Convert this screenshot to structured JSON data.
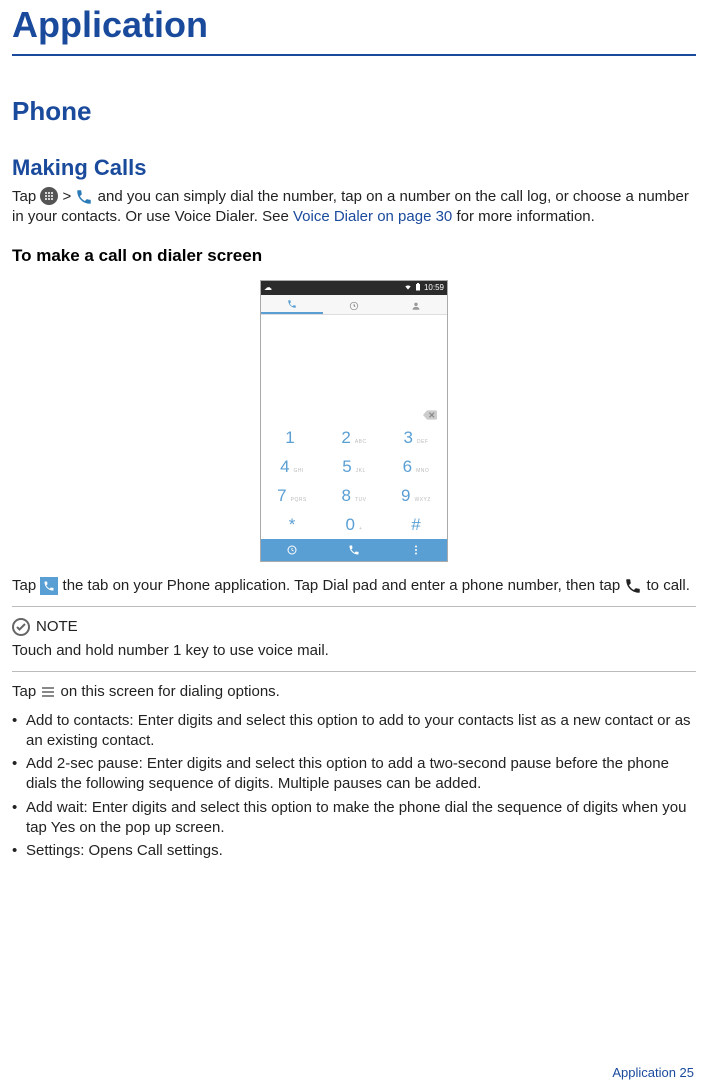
{
  "title": "Application",
  "section": "Phone",
  "subsection": "Making Calls",
  "intro": {
    "part1": "Tap ",
    "gt": " > ",
    "part2": " and you can simply dial the number, tap on a number on the call log, or choose a number in your contacts. Or use Voice Dialer. See ",
    "link": "Voice Dialer on page 30",
    "part3": " for more information."
  },
  "heading_dialer": "To make a call on dialer screen",
  "screenshot": {
    "status_time": "10:59",
    "keys": [
      {
        "digit": "1",
        "letters": ""
      },
      {
        "digit": "2",
        "letters": "ABC"
      },
      {
        "digit": "3",
        "letters": "DEF"
      },
      {
        "digit": "4",
        "letters": "GHI"
      },
      {
        "digit": "5",
        "letters": "JKL"
      },
      {
        "digit": "6",
        "letters": "MNO"
      },
      {
        "digit": "7",
        "letters": "PQRS"
      },
      {
        "digit": "8",
        "letters": "TUV"
      },
      {
        "digit": "9",
        "letters": "WXYZ"
      },
      {
        "digit": "*",
        "letters": ""
      },
      {
        "digit": "0",
        "letters": "+"
      },
      {
        "digit": "#",
        "letters": ""
      }
    ]
  },
  "after_shot": {
    "part1": "Tap ",
    "part2": " the tab on your Phone application. Tap Dial pad and enter a phone  number, then tap ",
    "part3": " to call."
  },
  "note_label": "NOTE",
  "note_text": "Touch and hold number 1 key to use voice  mail.",
  "options_intro": {
    "part1": "Tap ",
    "part2": " on this screen for dialing  options."
  },
  "bullets": [
    "Add to contacts: Enter digits and select this option to add to your contacts list as a new contact or as an existing contact.",
    "Add 2-sec pause: Enter digits and select this option to add a two-second pause before the phone dials the following sequence of digits. Multiple pauses can be added.",
    "Add wait: Enter digits and select this option to make the phone dial the sequence of digits when you tap Yes on the pop up screen.",
    "Settings: Opens Call  settings."
  ],
  "footer": "Application  25"
}
